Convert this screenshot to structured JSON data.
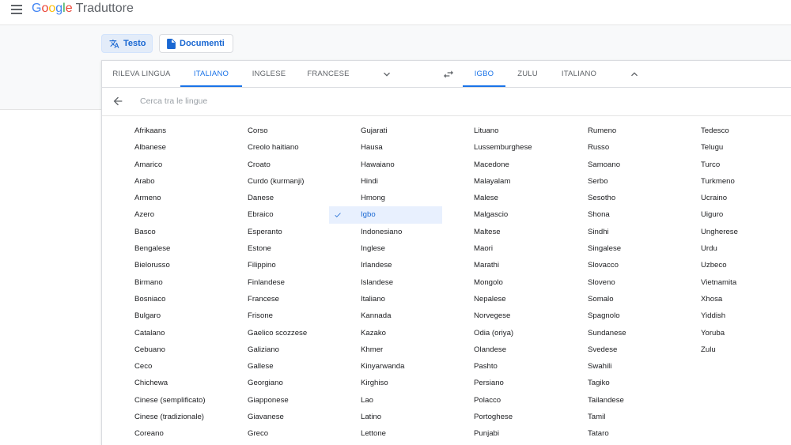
{
  "header": {
    "logo_google": "Google",
    "app_name": "Traduttore"
  },
  "modes": {
    "text_label": "Testo",
    "documents_label": "Documenti"
  },
  "source_tabs": [
    "RILEVA LINGUA",
    "ITALIANO",
    "INGLESE",
    "FRANCESE"
  ],
  "source_active_index": 1,
  "target_tabs": [
    "IGBO",
    "ZULU",
    "ITALIANO"
  ],
  "target_active_index": 0,
  "search": {
    "placeholder": "Cerca tra le lingue",
    "value": ""
  },
  "selected_language": "Igbo",
  "language_columns": [
    [
      "Afrikaans",
      "Albanese",
      "Amarico",
      "Arabo",
      "Armeno",
      "Azero",
      "Basco",
      "Bengalese",
      "Bielorusso",
      "Birmano",
      "Bosniaco",
      "Bulgaro",
      "Catalano",
      "Cebuano",
      "Ceco",
      "Chichewa",
      "Cinese (semplificato)",
      "Cinese (tradizionale)",
      "Coreano"
    ],
    [
      "Corso",
      "Creolo haitiano",
      "Croato",
      "Curdo (kurmanji)",
      "Danese",
      "Ebraico",
      "Esperanto",
      "Estone",
      "Filippino",
      "Finlandese",
      "Francese",
      "Frisone",
      "Gaelico scozzese",
      "Galiziano",
      "Gallese",
      "Georgiano",
      "Giapponese",
      "Giavanese",
      "Greco"
    ],
    [
      "Gujarati",
      "Hausa",
      "Hawaiano",
      "Hindi",
      "Hmong",
      "Igbo",
      "Indonesiano",
      "Inglese",
      "Irlandese",
      "Islandese",
      "Italiano",
      "Kannada",
      "Kazako",
      "Khmer",
      "Kinyarwanda",
      "Kirghiso",
      "Lao",
      "Latino",
      "Lettone"
    ],
    [
      "Lituano",
      "Lussemburghese",
      "Macedone",
      "Malayalam",
      "Malese",
      "Malgascio",
      "Maltese",
      "Maori",
      "Marathi",
      "Mongolo",
      "Nepalese",
      "Norvegese",
      "Odia (oriya)",
      "Olandese",
      "Pashto",
      "Persiano",
      "Polacco",
      "Portoghese",
      "Punjabi"
    ],
    [
      "Rumeno",
      "Russo",
      "Samoano",
      "Serbo",
      "Sesotho",
      "Shona",
      "Sindhi",
      "Singalese",
      "Slovacco",
      "Sloveno",
      "Somalo",
      "Spagnolo",
      "Sundanese",
      "Svedese",
      "Swahili",
      "Tagiko",
      "Tailandese",
      "Tamil",
      "Tataro"
    ],
    [
      "Tedesco",
      "Telugu",
      "Turco",
      "Turkmeno",
      "Ucraino",
      "Uiguro",
      "Ungherese",
      "Urdu",
      "Uzbeco",
      "Vietnamita",
      "Xhosa",
      "Yiddish",
      "Yoruba",
      "Zulu"
    ]
  ],
  "colors": {
    "accent": "#1a73e8",
    "selected_bg": "#e8f0fe",
    "page_gray": "#f8f9fa"
  }
}
